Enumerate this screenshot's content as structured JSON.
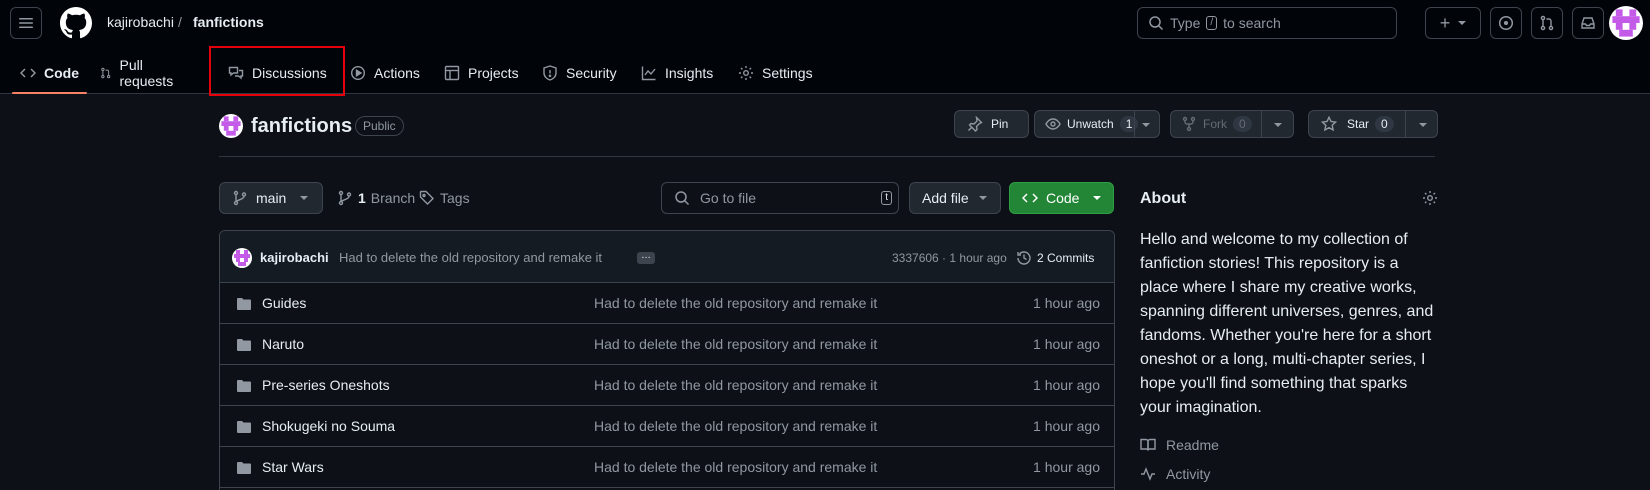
{
  "header": {
    "owner": "kajirobachi",
    "separator": "/",
    "repo": "fanfictions",
    "search": {
      "prefix": "Type",
      "key": "/",
      "suffix": "to search"
    },
    "new_label": "+"
  },
  "nav": {
    "tabs": [
      {
        "label": "Code",
        "icon": "code-icon",
        "active": true
      },
      {
        "label": "Pull requests",
        "icon": "git-pull-request-icon"
      },
      {
        "label": "Discussions",
        "icon": "comment-discussion-icon",
        "highlighted": true
      },
      {
        "label": "Actions",
        "icon": "play-icon"
      },
      {
        "label": "Projects",
        "icon": "table-icon"
      },
      {
        "label": "Security",
        "icon": "shield-icon"
      },
      {
        "label": "Insights",
        "icon": "graph-icon"
      },
      {
        "label": "Settings",
        "icon": "gear-icon"
      }
    ],
    "highlight_color": "#e5000b"
  },
  "repo": {
    "name": "fanfictions",
    "visibility": "Public",
    "pin_label": "Pin",
    "unwatch_label": "Unwatch",
    "watch_count": "1",
    "fork_label": "Fork",
    "fork_count": "0",
    "star_label": "Star",
    "star_count": "0"
  },
  "filenav": {
    "branch": "main",
    "branch_count": "1",
    "branch_label": "Branch",
    "tags_label": "Tags",
    "goto_placeholder": "Go to file",
    "goto_key": "t",
    "addfile_label": "Add file",
    "code_label": "Code"
  },
  "commit": {
    "user": "kajirobachi",
    "message": "Had to delete the old repository and remake it",
    "sha_time": "3337606 · 1 hour ago",
    "commits_label": "2 Commits"
  },
  "files": [
    {
      "name": "Guides",
      "message": "Had to delete the old repository and remake it",
      "time": "1 hour ago"
    },
    {
      "name": "Naruto",
      "message": "Had to delete the old repository and remake it",
      "time": "1 hour ago"
    },
    {
      "name": "Pre-series Oneshots",
      "message": "Had to delete the old repository and remake it",
      "time": "1 hour ago"
    },
    {
      "name": "Shokugeki no Souma",
      "message": "Had to delete the old repository and remake it",
      "time": "1 hour ago"
    },
    {
      "name": "Star Wars",
      "message": "Had to delete the old repository and remake it",
      "time": "1 hour ago"
    }
  ],
  "about": {
    "title": "About",
    "description": "Hello and welcome to my collection of fanfiction stories! This repository is a place where I share my creative works, spanning different universes, genres, and fandoms. Whether you're here for a short oneshot or a long, multi-chapter series, I hope you'll find something that sparks your imagination.",
    "readme_label": "Readme",
    "activity_label": "Activity"
  },
  "colors": {
    "bg": "#0d1117",
    "header_bg": "#010409",
    "accent_underline": "#f78166",
    "code_button": "#238636",
    "avatar_purple": "#c35be8"
  }
}
